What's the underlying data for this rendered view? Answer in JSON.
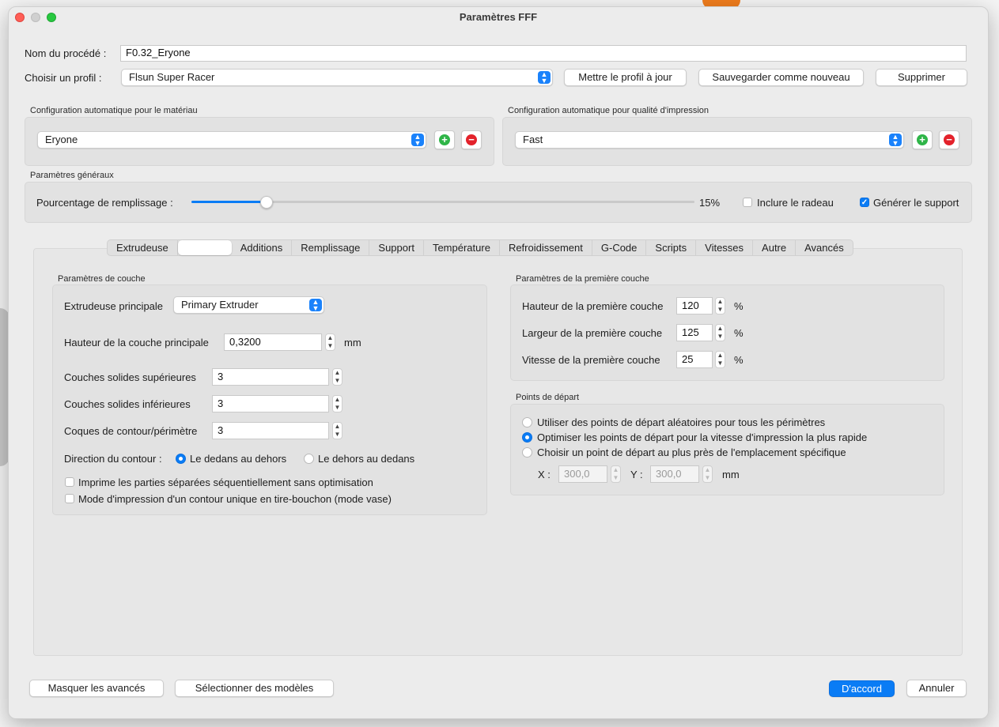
{
  "window": {
    "title": "Paramètres FFF"
  },
  "process": {
    "name_label": "Nom du procédé :",
    "name_value": "F0.32_Eryone",
    "profile_label": "Choisir un profil :",
    "profile_value": "Flsun Super Racer",
    "update_profile_label": "Mettre le profil à jour",
    "save_as_new_label": "Sauvegarder comme nouveau",
    "delete_label": "Supprimer"
  },
  "material_config": {
    "title": "Configuration automatique pour le matériau",
    "value": "Eryone"
  },
  "quality_config": {
    "title": "Configuration automatique pour qualité d'impression",
    "value": "Fast"
  },
  "general": {
    "title": "Paramètres généraux",
    "infill_label": "Pourcentage de remplissage :",
    "infill_value": "15%",
    "infill_fraction": 0.15,
    "raft_label": "Inclure le radeau",
    "raft_checked": false,
    "support_label": "Générer le support",
    "support_checked": true
  },
  "tabs": [
    {
      "label": "Extrudeuse",
      "selected": false
    },
    {
      "label": "",
      "selected": true
    },
    {
      "label": "Additions",
      "selected": false
    },
    {
      "label": "Remplissage",
      "selected": false
    },
    {
      "label": "Support",
      "selected": false
    },
    {
      "label": "Température",
      "selected": false
    },
    {
      "label": "Refroidissement",
      "selected": false
    },
    {
      "label": "G-Code",
      "selected": false
    },
    {
      "label": "Scripts",
      "selected": false
    },
    {
      "label": "Vitesses",
      "selected": false
    },
    {
      "label": "Autre",
      "selected": false
    },
    {
      "label": "Avancés",
      "selected": false
    }
  ],
  "layer": {
    "title": "Paramètres de couche",
    "main_extruder_label": "Extrudeuse principale",
    "main_extruder_value": "Primary Extruder",
    "main_layer_height_label": "Hauteur de la couche principale",
    "main_layer_height_value": "0,3200",
    "main_layer_height_unit": "mm",
    "top_solid_label": "Couches solides supérieures",
    "top_solid_value": "3",
    "bottom_solid_label": "Couches solides inférieures",
    "bottom_solid_value": "3",
    "perimeter_label": "Coques de contour/périmètre",
    "perimeter_value": "3",
    "direction_label": "Direction du contour :",
    "direction_inside_out": "Le dedans au dehors",
    "direction_outside_in": "Le dehors au dedans",
    "sequential_label": "Imprime les parties séparées séquentiellement sans optimisation",
    "vase_label": "Mode d'impression d'un contour unique en tire-bouchon (mode vase)"
  },
  "first_layer": {
    "title": "Paramètres de la première couche",
    "height_label": "Hauteur de la première couche",
    "height_value": "120",
    "width_label": "Largeur de la première couche",
    "width_value": "125",
    "speed_label": "Vitesse de la première couche",
    "speed_value": "25",
    "unit": "%"
  },
  "start_points": {
    "title": "Points de départ",
    "random_label": "Utiliser des points de départ aléatoires pour tous les périmètres",
    "optimize_label": "Optimiser les points de départ pour la vitesse d'impression la plus rapide",
    "specific_label": "Choisir un point de départ au plus près de l'emplacement spécifique",
    "x_label": "X :",
    "x_value": "300,0",
    "y_label": "Y :",
    "y_value": "300,0",
    "unit": "mm"
  },
  "footer": {
    "hide_advanced_label": "Masquer les avancés",
    "select_models_label": "Sélectionner des modèles",
    "ok_label": "D'accord",
    "cancel_label": "Annuler"
  },
  "colors": {
    "accent": "#0a7cf5",
    "add": "#2fb548",
    "remove": "#e3222b"
  }
}
